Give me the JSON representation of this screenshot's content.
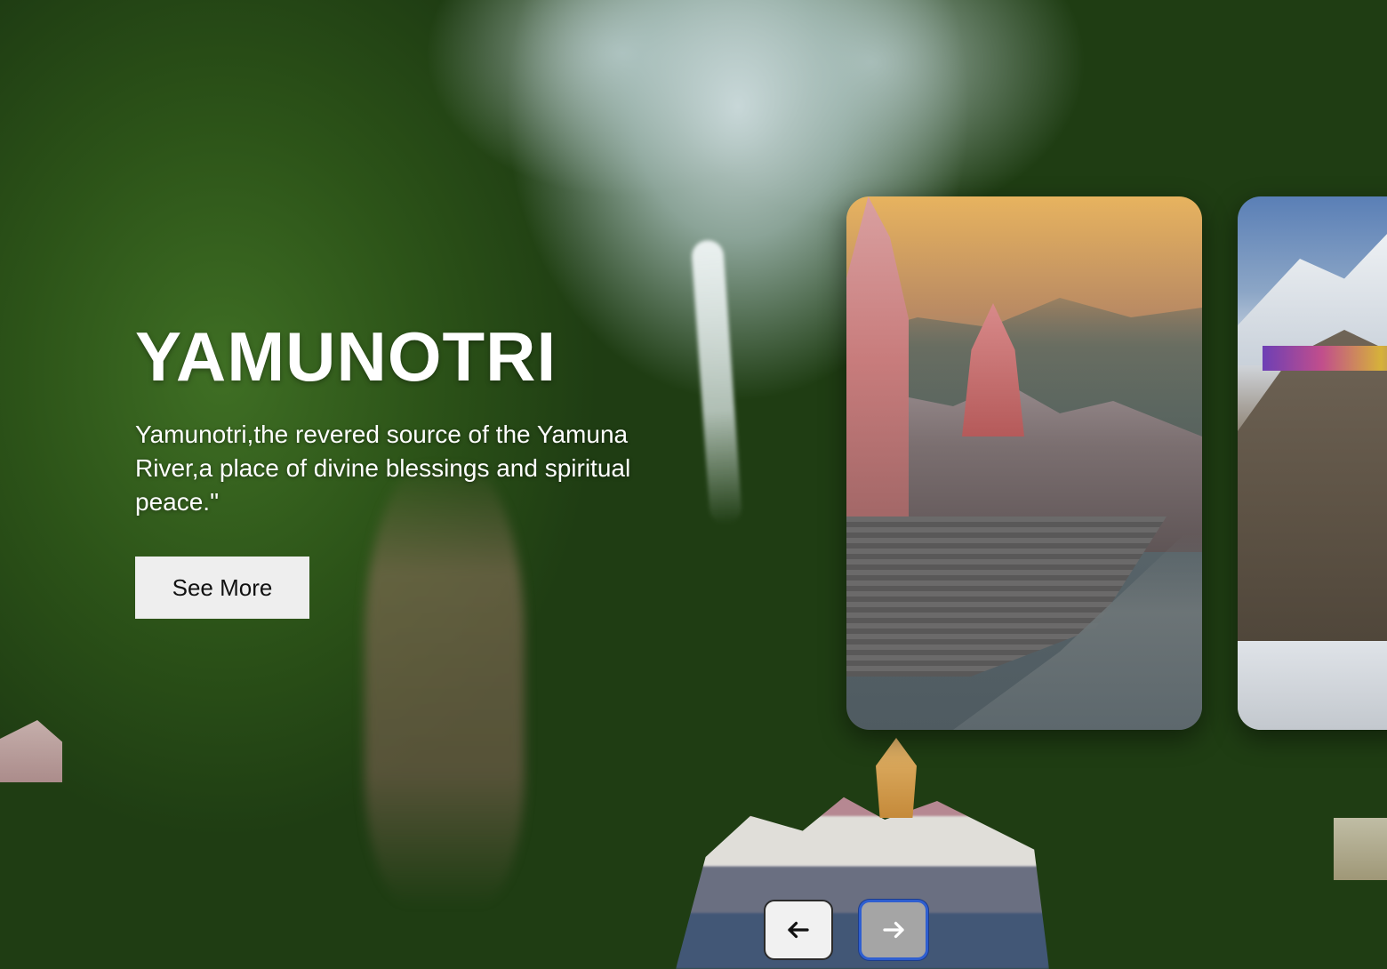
{
  "hero": {
    "title": "YAMUNOTRI",
    "description": "Yamunotri,the revered source of the Yamuna River,a place of divine blessings and spiritual peace.\"",
    "button_label": "See More"
  },
  "cards": [
    {
      "scene": "ghats-by-river-temples"
    },
    {
      "scene": "snow-mountain-temple"
    }
  ],
  "navigation": {
    "prev_icon": "arrow-left-icon",
    "next_icon": "arrow-right-icon"
  },
  "colors": {
    "button_bg": "#eeeeee",
    "next_focus_ring": "#2f5fd0",
    "prev_bg": "#f1f1f1",
    "next_bg": "#a5a5a5"
  }
}
